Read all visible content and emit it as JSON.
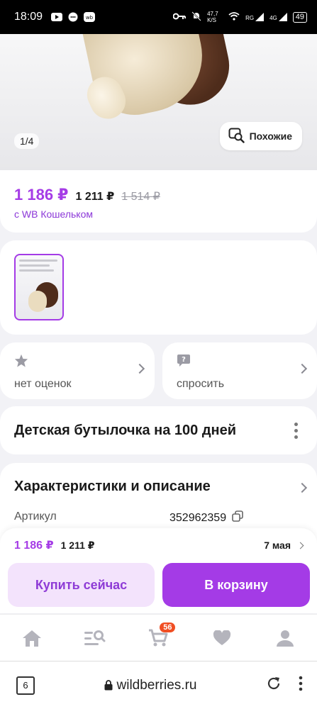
{
  "status_bar": {
    "time": "18:09",
    "speed": "47,7 K/S",
    "net1": "RG",
    "net2": "4G",
    "battery": "49"
  },
  "gallery": {
    "pager": "1/4",
    "similar_label": "Похожие"
  },
  "price": {
    "main": "1 186 ₽",
    "second": "1 211 ₽",
    "old": "1 514 ₽",
    "note": "с WB Кошельком"
  },
  "rating": {
    "label": "нет оценок"
  },
  "ask": {
    "label": "спросить"
  },
  "product": {
    "title": "Детская бутылочка на 100 дней"
  },
  "characteristics": {
    "heading": "Характеристики и описание",
    "rows": [
      {
        "key": "Артикул",
        "value": "352962359"
      }
    ]
  },
  "buy_panel": {
    "price_main": "1 186 ₽",
    "price_second": "1 211 ₽",
    "delivery_date": "7 мая",
    "buy_now_label": "Купить сейчас",
    "add_cart_label": "В корзину"
  },
  "nav": {
    "cart_badge": "56"
  },
  "browser": {
    "tabs_count": "6",
    "url": "wildberries.ru"
  },
  "colors": {
    "accent": "#a43be6",
    "accent_light": "#f3e3fc",
    "badge": "#f04e23"
  }
}
